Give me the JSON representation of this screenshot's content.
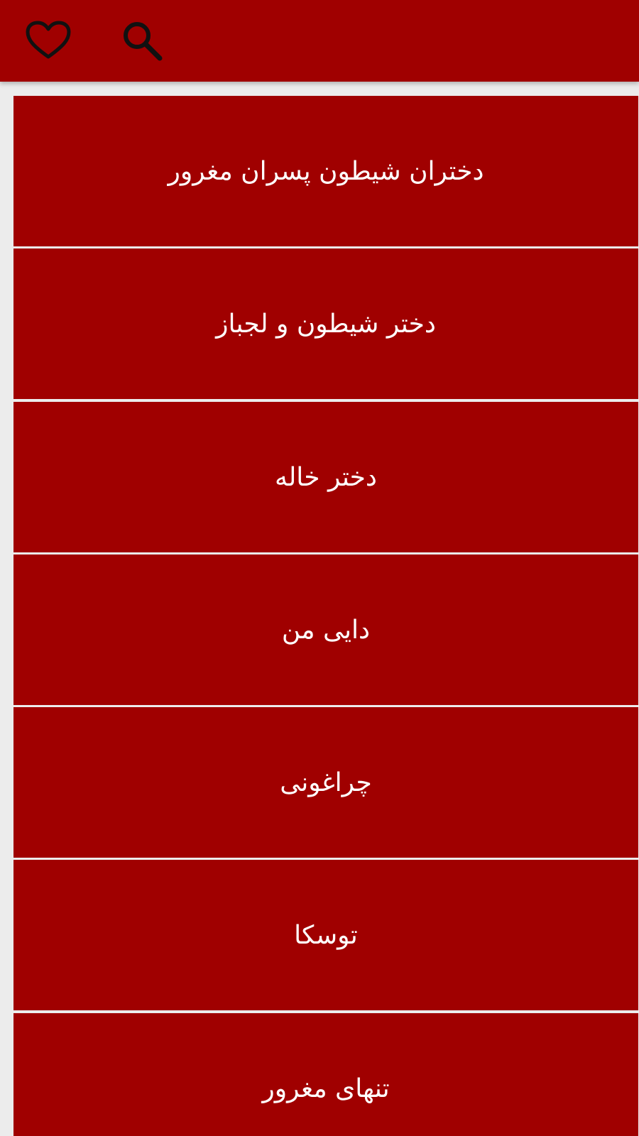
{
  "colors": {
    "primary": "#a00000",
    "background": "#ececec",
    "text_on_primary": "#ffffff",
    "icon": "#111111"
  },
  "toolbar": {
    "favorite_icon": "heart-outline-icon",
    "search_icon": "magnifier-icon"
  },
  "stories": [
    {
      "title": "دختران شیطون پسران مغرور"
    },
    {
      "title": "دختر شیطون و لجباز"
    },
    {
      "title": "دختر خاله"
    },
    {
      "title": "دایی من"
    },
    {
      "title": "چراغونی"
    },
    {
      "title": "توسکا"
    },
    {
      "title": "تنهای مغرور"
    }
  ]
}
